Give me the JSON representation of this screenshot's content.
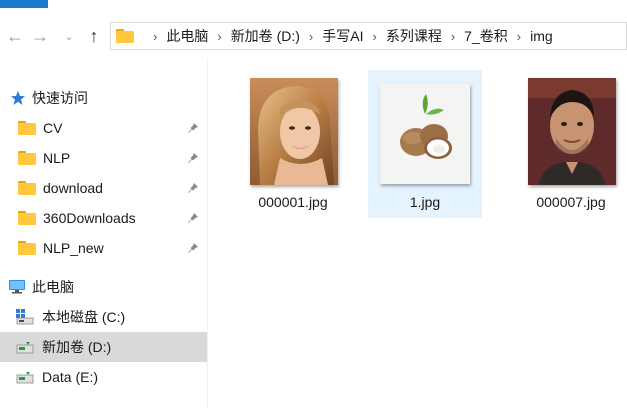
{
  "address_bar": {
    "crumbs": [
      "此电脑",
      "新加卷 (D:)",
      "手写AI",
      "系列课程",
      "7_卷积",
      "img"
    ]
  },
  "sidebar": {
    "quick_access_label": "快速访问",
    "quick_items": [
      {
        "label": "CV",
        "pinned": true
      },
      {
        "label": "NLP",
        "pinned": true
      },
      {
        "label": "download",
        "pinned": true
      },
      {
        "label": "360Downloads",
        "pinned": true
      },
      {
        "label": "NLP_new",
        "pinned": true
      }
    ],
    "this_pc_label": "此电脑",
    "drives": [
      {
        "label": "本地磁盘 (C:)"
      },
      {
        "label": "新加卷 (D:)",
        "selected": true
      },
      {
        "label": "Data (E:)"
      }
    ]
  },
  "files": [
    {
      "name": "000001.jpg",
      "thumbnail": "woman-portrait-photo"
    },
    {
      "name": "1.jpg",
      "thumbnail": "coconut-photo",
      "selected": true
    },
    {
      "name": "000007.jpg",
      "thumbnail": "man-portrait-photo"
    }
  ],
  "colors": {
    "folder": "#ffc83d",
    "selection": "#e5f3ff",
    "sidebar_selected": "#d9d9d9",
    "accent": "#1979ca"
  }
}
